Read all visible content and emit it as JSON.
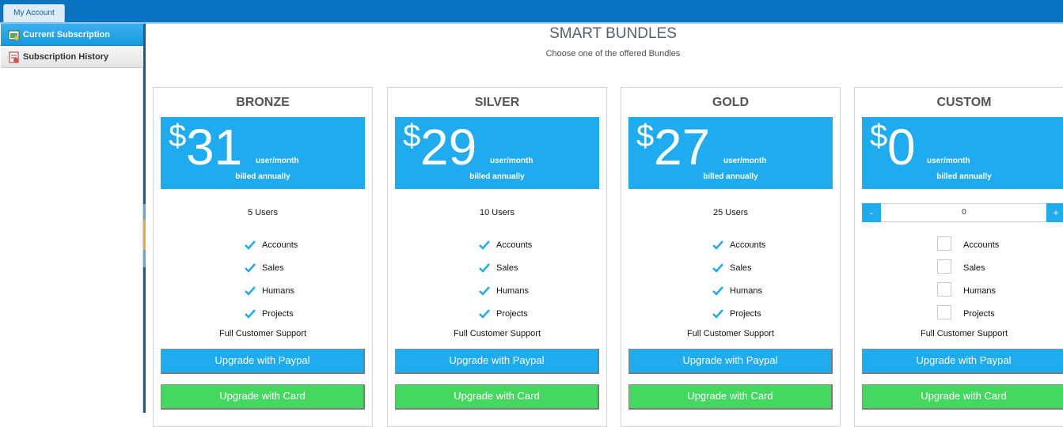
{
  "topbar": {
    "tab_label": "My Account"
  },
  "sidebar": {
    "items": [
      {
        "label": "Current Subscription",
        "icon": "subscription-icon"
      },
      {
        "label": "Subscription History",
        "icon": "history-icon"
      }
    ]
  },
  "main": {
    "title": "SMART BUNDLES",
    "subtitle": "Choose one of the offered Bundles"
  },
  "bundles": [
    {
      "name": "BRONZE",
      "currency": "$",
      "price": "31",
      "per": "user/month",
      "billing": "billed annually",
      "users": "5 Users",
      "features": [
        "Accounts",
        "Sales",
        "Humans",
        "Projects"
      ],
      "support": "Full Customer Support",
      "paypal": "Upgrade with Paypal",
      "card": "Upgrade with Card"
    },
    {
      "name": "SILVER",
      "currency": "$",
      "price": "29",
      "per": "user/month",
      "billing": "billed annually",
      "users": "10 Users",
      "features": [
        "Accounts",
        "Sales",
        "Humans",
        "Projects"
      ],
      "support": "Full Customer Support",
      "paypal": "Upgrade with Paypal",
      "card": "Upgrade with Card"
    },
    {
      "name": "GOLD",
      "currency": "$",
      "price": "27",
      "per": "user/month",
      "billing": "billed annually",
      "users": "25 Users",
      "features": [
        "Accounts",
        "Sales",
        "Humans",
        "Projects"
      ],
      "support": "Full Customer Support",
      "paypal": "Upgrade with Paypal",
      "card": "Upgrade with Card"
    },
    {
      "name": "CUSTOM",
      "currency": "$",
      "price": "0",
      "per": "user/month",
      "billing": "billed annually",
      "stepper": {
        "minus": "-",
        "value": "0",
        "plus": "+"
      },
      "features": [
        "Accounts",
        "Sales",
        "Humans",
        "Projects"
      ],
      "support": "Full Customer Support",
      "paypal": "Upgrade with Paypal",
      "card": "Upgrade with Card"
    }
  ],
  "colors": {
    "accent": "#1fabef",
    "card_button": "#45d860",
    "topbar": "#0b74c2"
  }
}
